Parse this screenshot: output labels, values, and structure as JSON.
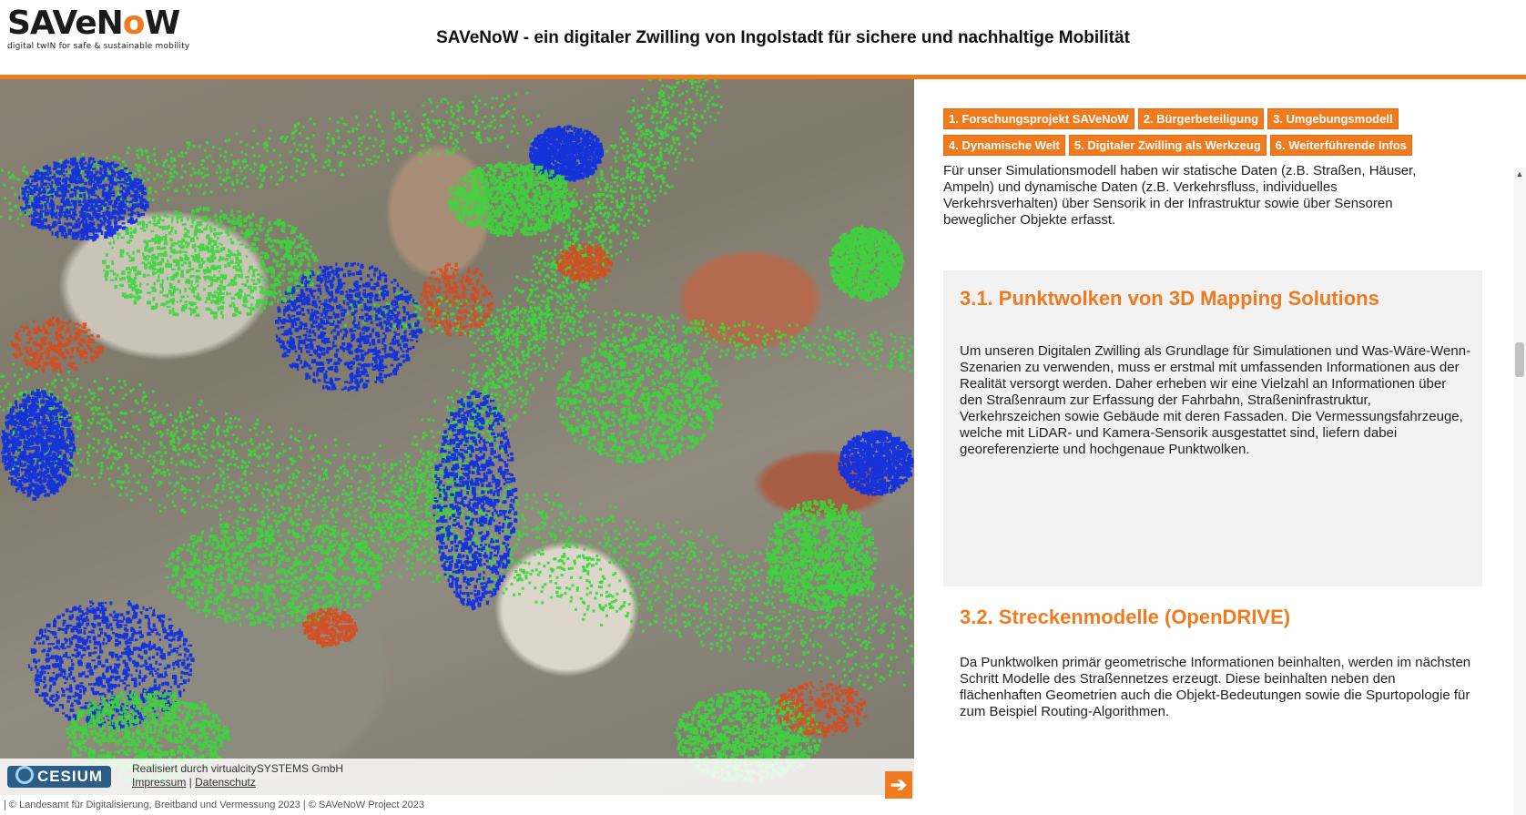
{
  "header": {
    "logo_main": "SAVeNoW",
    "logo_tagline": "digital twIN for safe & sustainable mobility",
    "title": "SAVeNoW - ein digitaler Zwilling von Ingolstadt für sichere und nachhaltige Mobilität"
  },
  "map": {
    "cesium_label": "CESIUM",
    "credit_line": "Realisiert durch virtualcitySYSTEMS GmbH",
    "impressum": "Impressum",
    "separator": " | ",
    "datenschutz": "Datenschutz",
    "next_arrow": "➔",
    "copyright": "| © Landesamt für Digitalisierung, Breitband und Vermessung 2023 | © SAVeNoW Project 2023"
  },
  "nav": {
    "items": [
      "1. Forschungsprojekt SAVeNoW",
      "2. Bürgerbeteiligung",
      "3. Umgebungsmodell",
      "4. Dynamische Welt",
      "5. Digitaler Zwilling als Werkzeug",
      "6. Weiterführende Infos"
    ]
  },
  "content": {
    "intro": "Für unser Simulationsmodell haben wir statische Daten (z.B. Straßen, Häuser, Ampeln) und dynamische Daten (z.B. Verkehrsfluss, individuelles Verkehrsverhalten) über Sensorik in der Infrastruktur sowie über Sensoren beweglicher Objekte erfasst.",
    "section1_title": "3.1. Punktwolken von 3D Mapping Solutions",
    "section1_text": "Um unseren Digitalen Zwilling als Grundlage für Simulationen und Was-Wäre-Wenn-Szenarien zu verwenden, muss er erstmal mit umfassenden Informationen aus der Realität versorgt werden. Daher erheben wir eine Vielzahl an Informationen über den Straßenraum zur Erfassung der Fahrbahn, Straßeninfrastruktur, Verkehrszeichen sowie Gebäude mit deren Fassaden. Die Vermessungsfahrzeuge, welche mit LiDAR- und Kamera-Sensorik ausgestattet sind, liefern dabei georeferenzierte und hochgenaue Punktwolken.",
    "section2_title": "3.2. Streckenmodelle (OpenDRIVE)",
    "section2_text": "Da Punktwolken primär geometrische Informationen beinhalten, werden im nächsten Schritt Modelle des Straßennetzes erzeugt. Diese beinhalten neben den flächenhaften Geometrien auch die Objekt-Bedeutungen sowie die Spurtopologie für zum Beispiel Routing-Algorithmen."
  },
  "colors": {
    "accent": "#f07a1e",
    "pointcloud_ground": "#3ad83a",
    "pointcloud_building": "#1030e0",
    "pointcloud_misc": "#e04818"
  }
}
